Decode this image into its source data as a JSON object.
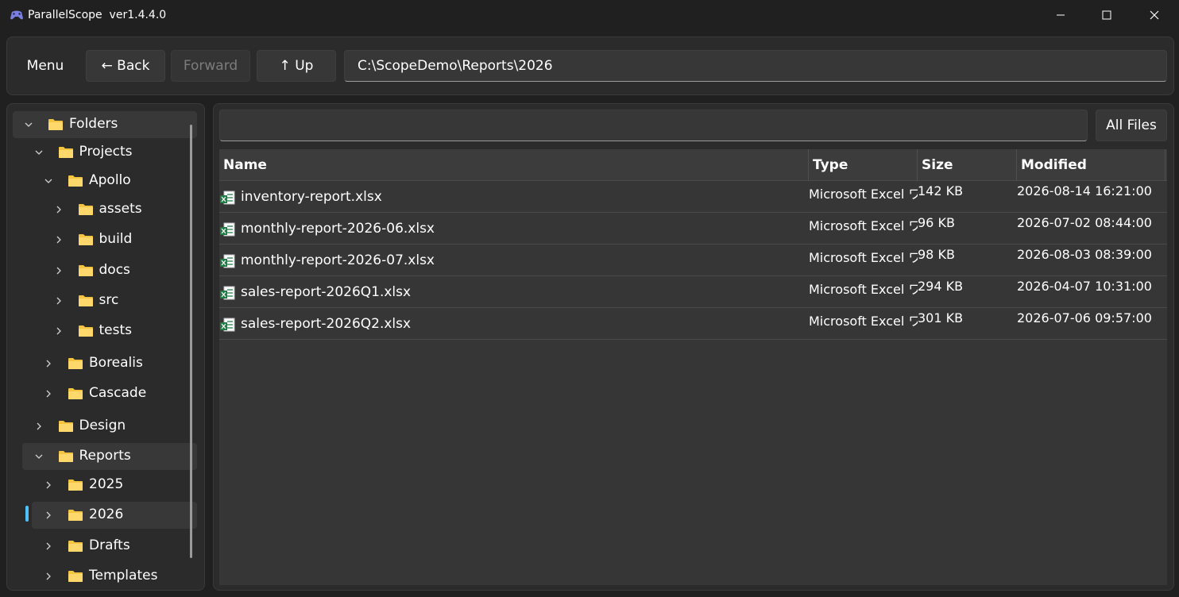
{
  "window": {
    "title": "ParallelScope  ver1.4.4.0",
    "minimize_icon": "minimize-icon",
    "maximize_icon": "maximize-icon",
    "close_icon": "close-icon"
  },
  "toolbar": {
    "menu_label": "Menu",
    "back_label": "← Back",
    "forward_label": "Forward",
    "up_label": "↑ Up",
    "path_value": "C:\\ScopeDemo\\Reports\\2026"
  },
  "tree": {
    "items": [
      {
        "label": "Folders",
        "expanded": true
      },
      {
        "label": "Projects",
        "expanded": true
      },
      {
        "label": "Apollo",
        "expanded": true
      },
      {
        "label": "assets",
        "expanded": false
      },
      {
        "label": "build",
        "expanded": false
      },
      {
        "label": "docs",
        "expanded": false
      },
      {
        "label": "src",
        "expanded": false
      },
      {
        "label": "tests",
        "expanded": false
      },
      {
        "label": "Borealis",
        "expanded": false
      },
      {
        "label": "Cascade",
        "expanded": false
      },
      {
        "label": "Design",
        "expanded": false
      },
      {
        "label": "Reports",
        "expanded": true
      },
      {
        "label": "2025",
        "expanded": false
      },
      {
        "label": "2026",
        "expanded": false,
        "selected": true
      },
      {
        "label": "Drafts",
        "expanded": false
      },
      {
        "label": "Templates",
        "expanded": false
      }
    ]
  },
  "search": {
    "value": "",
    "filter_label": "All Files"
  },
  "grid": {
    "columns": [
      "Name",
      "Type",
      "Size",
      "Modified"
    ],
    "rows": [
      {
        "name": "inventory-report.xlsx",
        "type": "Microsoft Excel ワ",
        "size": "142 KB",
        "modified": "2026-08-14 16:21:00"
      },
      {
        "name": "monthly-report-2026-06.xlsx",
        "type": "Microsoft Excel ワ",
        "size": "96 KB",
        "modified": "2026-07-02 08:44:00"
      },
      {
        "name": "monthly-report-2026-07.xlsx",
        "type": "Microsoft Excel ワ",
        "size": "98 KB",
        "modified": "2026-08-03 08:39:00"
      },
      {
        "name": "sales-report-2026Q1.xlsx",
        "type": "Microsoft Excel ワ",
        "size": "294 KB",
        "modified": "2026-04-07 10:31:00"
      },
      {
        "name": "sales-report-2026Q2.xlsx",
        "type": "Microsoft Excel ワ",
        "size": "301 KB",
        "modified": "2026-07-06 09:57:00"
      }
    ]
  },
  "colors": {
    "accent": "#4cc2ff",
    "folder": "#f5c542",
    "excel": "#1f7a43"
  }
}
